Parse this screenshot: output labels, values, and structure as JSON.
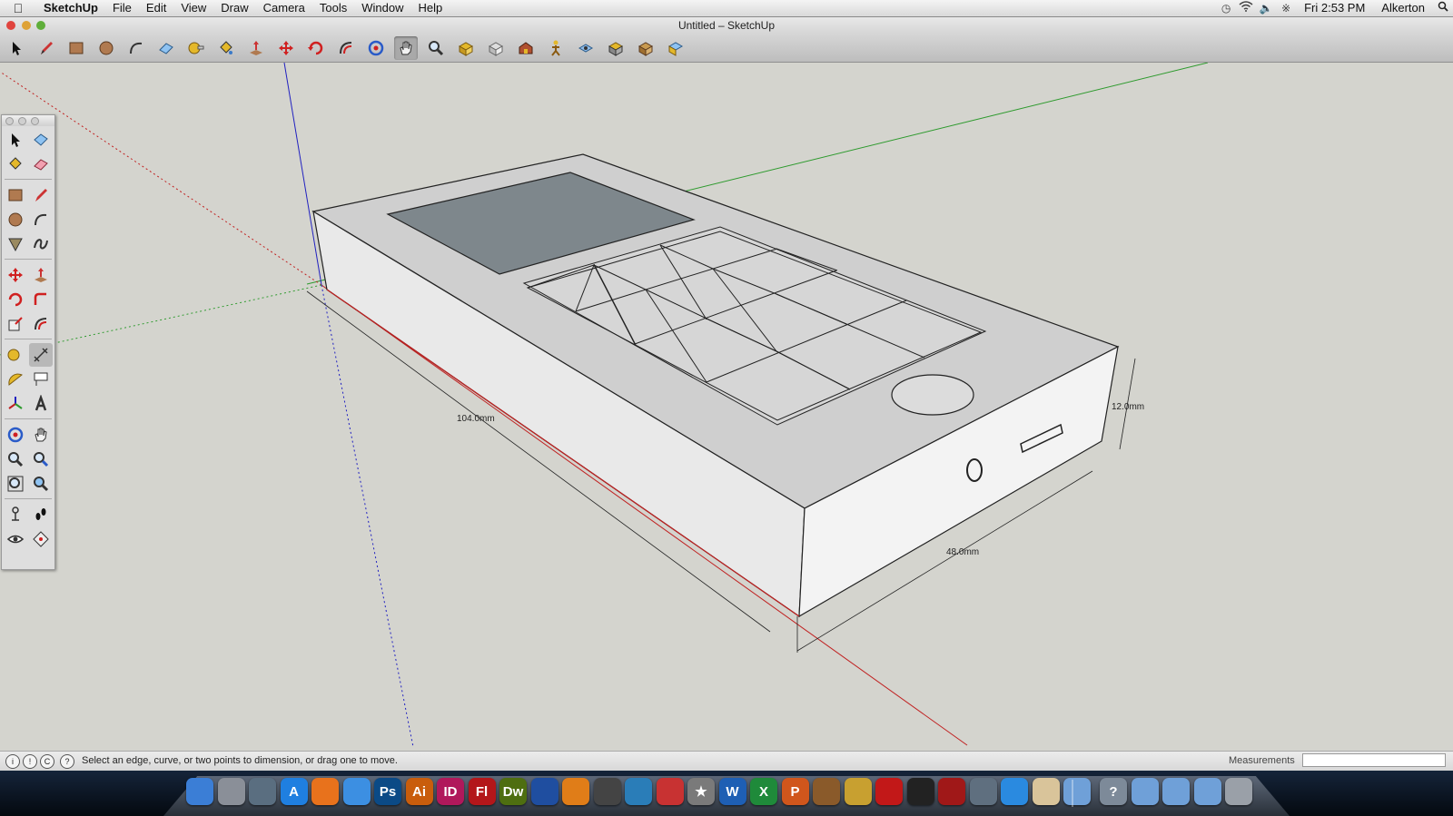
{
  "menubar": {
    "app_name": "SketchUp",
    "items": [
      "File",
      "Edit",
      "View",
      "Draw",
      "Camera",
      "Tools",
      "Window",
      "Help"
    ],
    "clock": "Fri 2:53 PM",
    "user": "Alkerton"
  },
  "window": {
    "title": "Untitled – SketchUp"
  },
  "toolbar": {
    "tools": [
      "select-tool",
      "pencil-tool",
      "rectangle-tool",
      "circle-tool",
      "arc-tool",
      "eraser-tool",
      "tape-measure-tool",
      "paint-bucket-tool",
      "push-pull-tool",
      "move-tool",
      "rotate-tool",
      "offset-tool",
      "orbit-tool",
      "pan-tool",
      "zoom-tool",
      "zoom-extents-tool",
      "previous-view-tool",
      "next-view-tool",
      "position-camera-tool",
      "walk-tool",
      "look-around-tool",
      "section-plane-tool",
      "get-models-tool",
      "share-model-tool"
    ],
    "active_tool": "pan-tool"
  },
  "model": {
    "dimensions": {
      "length": "104.0mm",
      "width": "48.0mm",
      "height": "12.0mm"
    }
  },
  "statusbar": {
    "hint": "Select an edge, curve, or two points to dimension, or drag one to move.",
    "measurements_label": "Measurements",
    "measurements_value": ""
  },
  "dock": {
    "apps": [
      {
        "name": "finder",
        "label": "",
        "color": "#3b7ed6"
      },
      {
        "name": "launchpad",
        "label": "",
        "color": "#8a8f98"
      },
      {
        "name": "dashboard",
        "label": "",
        "color": "#5a6e80"
      },
      {
        "name": "app-store",
        "label": "A",
        "color": "#1f7fe0"
      },
      {
        "name": "firefox",
        "label": "",
        "color": "#e8721c"
      },
      {
        "name": "safari",
        "label": "",
        "color": "#3c8fe2"
      },
      {
        "name": "photoshop",
        "label": "Ps",
        "color": "#0b4a86"
      },
      {
        "name": "illustrator",
        "label": "Ai",
        "color": "#c95d0c"
      },
      {
        "name": "indesign",
        "label": "ID",
        "color": "#b0185b"
      },
      {
        "name": "flash",
        "label": "Fl",
        "color": "#b3161a"
      },
      {
        "name": "dreamweaver",
        "label": "Dw",
        "color": "#4e6e10"
      },
      {
        "name": "soundbooth",
        "label": "",
        "color": "#1f4ea0"
      },
      {
        "name": "blender",
        "label": "",
        "color": "#e07d18"
      },
      {
        "name": "final-cut",
        "label": "",
        "color": "#444"
      },
      {
        "name": "crowd-app",
        "label": "",
        "color": "#2a7db8"
      },
      {
        "name": "sketchup-pencil",
        "label": "",
        "color": "#c83232"
      },
      {
        "name": "imovie-star",
        "label": "★",
        "color": "#7a7a7a"
      },
      {
        "name": "word",
        "label": "W",
        "color": "#1e5fb4"
      },
      {
        "name": "excel",
        "label": "X",
        "color": "#1f8a3a"
      },
      {
        "name": "powerpoint",
        "label": "P",
        "color": "#d0561c"
      },
      {
        "name": "garageband",
        "label": "",
        "color": "#8a5a2a"
      },
      {
        "name": "app-wizard",
        "label": "",
        "color": "#c8a030"
      },
      {
        "name": "flashget",
        "label": "",
        "color": "#c21818"
      },
      {
        "name": "dvd-player",
        "label": "",
        "color": "#222"
      },
      {
        "name": "photo-booth",
        "label": "",
        "color": "#a01818"
      },
      {
        "name": "iphoto",
        "label": "",
        "color": "#5f6f7f"
      },
      {
        "name": "itunes",
        "label": "",
        "color": "#2a8ae0"
      },
      {
        "name": "preview",
        "label": "",
        "color": "#d9c49a"
      },
      {
        "name": "applications-folder",
        "label": "",
        "color": "#6fa0d8"
      },
      {
        "name": "help",
        "label": "?",
        "color": "#7d8a99"
      },
      {
        "name": "apps-stack",
        "label": "",
        "color": "#6fa0d8"
      },
      {
        "name": "documents-folder",
        "label": "",
        "color": "#6fa0d8"
      },
      {
        "name": "downloads-folder",
        "label": "",
        "color": "#6fa0d8"
      },
      {
        "name": "trash",
        "label": "",
        "color": "#9aa0a8"
      }
    ]
  }
}
